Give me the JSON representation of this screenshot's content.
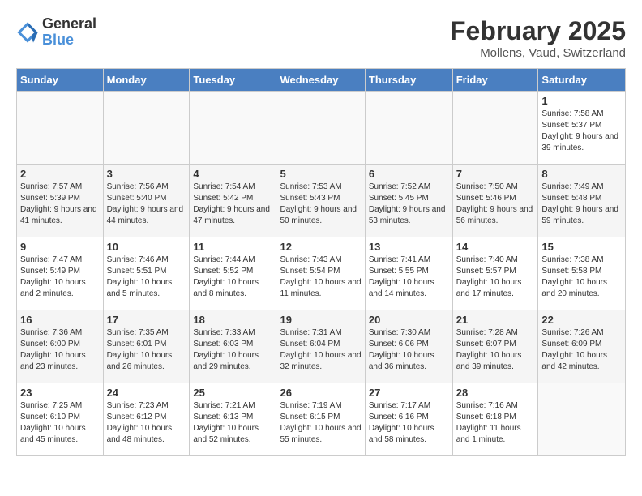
{
  "header": {
    "logo_line1": "General",
    "logo_line2": "Blue",
    "month": "February 2025",
    "location": "Mollens, Vaud, Switzerland"
  },
  "weekdays": [
    "Sunday",
    "Monday",
    "Tuesday",
    "Wednesday",
    "Thursday",
    "Friday",
    "Saturday"
  ],
  "weeks": [
    [
      {
        "day": "",
        "info": ""
      },
      {
        "day": "",
        "info": ""
      },
      {
        "day": "",
        "info": ""
      },
      {
        "day": "",
        "info": ""
      },
      {
        "day": "",
        "info": ""
      },
      {
        "day": "",
        "info": ""
      },
      {
        "day": "1",
        "info": "Sunrise: 7:58 AM\nSunset: 5:37 PM\nDaylight: 9 hours and 39 minutes."
      }
    ],
    [
      {
        "day": "2",
        "info": "Sunrise: 7:57 AM\nSunset: 5:39 PM\nDaylight: 9 hours and 41 minutes."
      },
      {
        "day": "3",
        "info": "Sunrise: 7:56 AM\nSunset: 5:40 PM\nDaylight: 9 hours and 44 minutes."
      },
      {
        "day": "4",
        "info": "Sunrise: 7:54 AM\nSunset: 5:42 PM\nDaylight: 9 hours and 47 minutes."
      },
      {
        "day": "5",
        "info": "Sunrise: 7:53 AM\nSunset: 5:43 PM\nDaylight: 9 hours and 50 minutes."
      },
      {
        "day": "6",
        "info": "Sunrise: 7:52 AM\nSunset: 5:45 PM\nDaylight: 9 hours and 53 minutes."
      },
      {
        "day": "7",
        "info": "Sunrise: 7:50 AM\nSunset: 5:46 PM\nDaylight: 9 hours and 56 minutes."
      },
      {
        "day": "8",
        "info": "Sunrise: 7:49 AM\nSunset: 5:48 PM\nDaylight: 9 hours and 59 minutes."
      }
    ],
    [
      {
        "day": "9",
        "info": "Sunrise: 7:47 AM\nSunset: 5:49 PM\nDaylight: 10 hours and 2 minutes."
      },
      {
        "day": "10",
        "info": "Sunrise: 7:46 AM\nSunset: 5:51 PM\nDaylight: 10 hours and 5 minutes."
      },
      {
        "day": "11",
        "info": "Sunrise: 7:44 AM\nSunset: 5:52 PM\nDaylight: 10 hours and 8 minutes."
      },
      {
        "day": "12",
        "info": "Sunrise: 7:43 AM\nSunset: 5:54 PM\nDaylight: 10 hours and 11 minutes."
      },
      {
        "day": "13",
        "info": "Sunrise: 7:41 AM\nSunset: 5:55 PM\nDaylight: 10 hours and 14 minutes."
      },
      {
        "day": "14",
        "info": "Sunrise: 7:40 AM\nSunset: 5:57 PM\nDaylight: 10 hours and 17 minutes."
      },
      {
        "day": "15",
        "info": "Sunrise: 7:38 AM\nSunset: 5:58 PM\nDaylight: 10 hours and 20 minutes."
      }
    ],
    [
      {
        "day": "16",
        "info": "Sunrise: 7:36 AM\nSunset: 6:00 PM\nDaylight: 10 hours and 23 minutes."
      },
      {
        "day": "17",
        "info": "Sunrise: 7:35 AM\nSunset: 6:01 PM\nDaylight: 10 hours and 26 minutes."
      },
      {
        "day": "18",
        "info": "Sunrise: 7:33 AM\nSunset: 6:03 PM\nDaylight: 10 hours and 29 minutes."
      },
      {
        "day": "19",
        "info": "Sunrise: 7:31 AM\nSunset: 6:04 PM\nDaylight: 10 hours and 32 minutes."
      },
      {
        "day": "20",
        "info": "Sunrise: 7:30 AM\nSunset: 6:06 PM\nDaylight: 10 hours and 36 minutes."
      },
      {
        "day": "21",
        "info": "Sunrise: 7:28 AM\nSunset: 6:07 PM\nDaylight: 10 hours and 39 minutes."
      },
      {
        "day": "22",
        "info": "Sunrise: 7:26 AM\nSunset: 6:09 PM\nDaylight: 10 hours and 42 minutes."
      }
    ],
    [
      {
        "day": "23",
        "info": "Sunrise: 7:25 AM\nSunset: 6:10 PM\nDaylight: 10 hours and 45 minutes."
      },
      {
        "day": "24",
        "info": "Sunrise: 7:23 AM\nSunset: 6:12 PM\nDaylight: 10 hours and 48 minutes."
      },
      {
        "day": "25",
        "info": "Sunrise: 7:21 AM\nSunset: 6:13 PM\nDaylight: 10 hours and 52 minutes."
      },
      {
        "day": "26",
        "info": "Sunrise: 7:19 AM\nSunset: 6:15 PM\nDaylight: 10 hours and 55 minutes."
      },
      {
        "day": "27",
        "info": "Sunrise: 7:17 AM\nSunset: 6:16 PM\nDaylight: 10 hours and 58 minutes."
      },
      {
        "day": "28",
        "info": "Sunrise: 7:16 AM\nSunset: 6:18 PM\nDaylight: 11 hours and 1 minute."
      },
      {
        "day": "",
        "info": ""
      }
    ]
  ]
}
